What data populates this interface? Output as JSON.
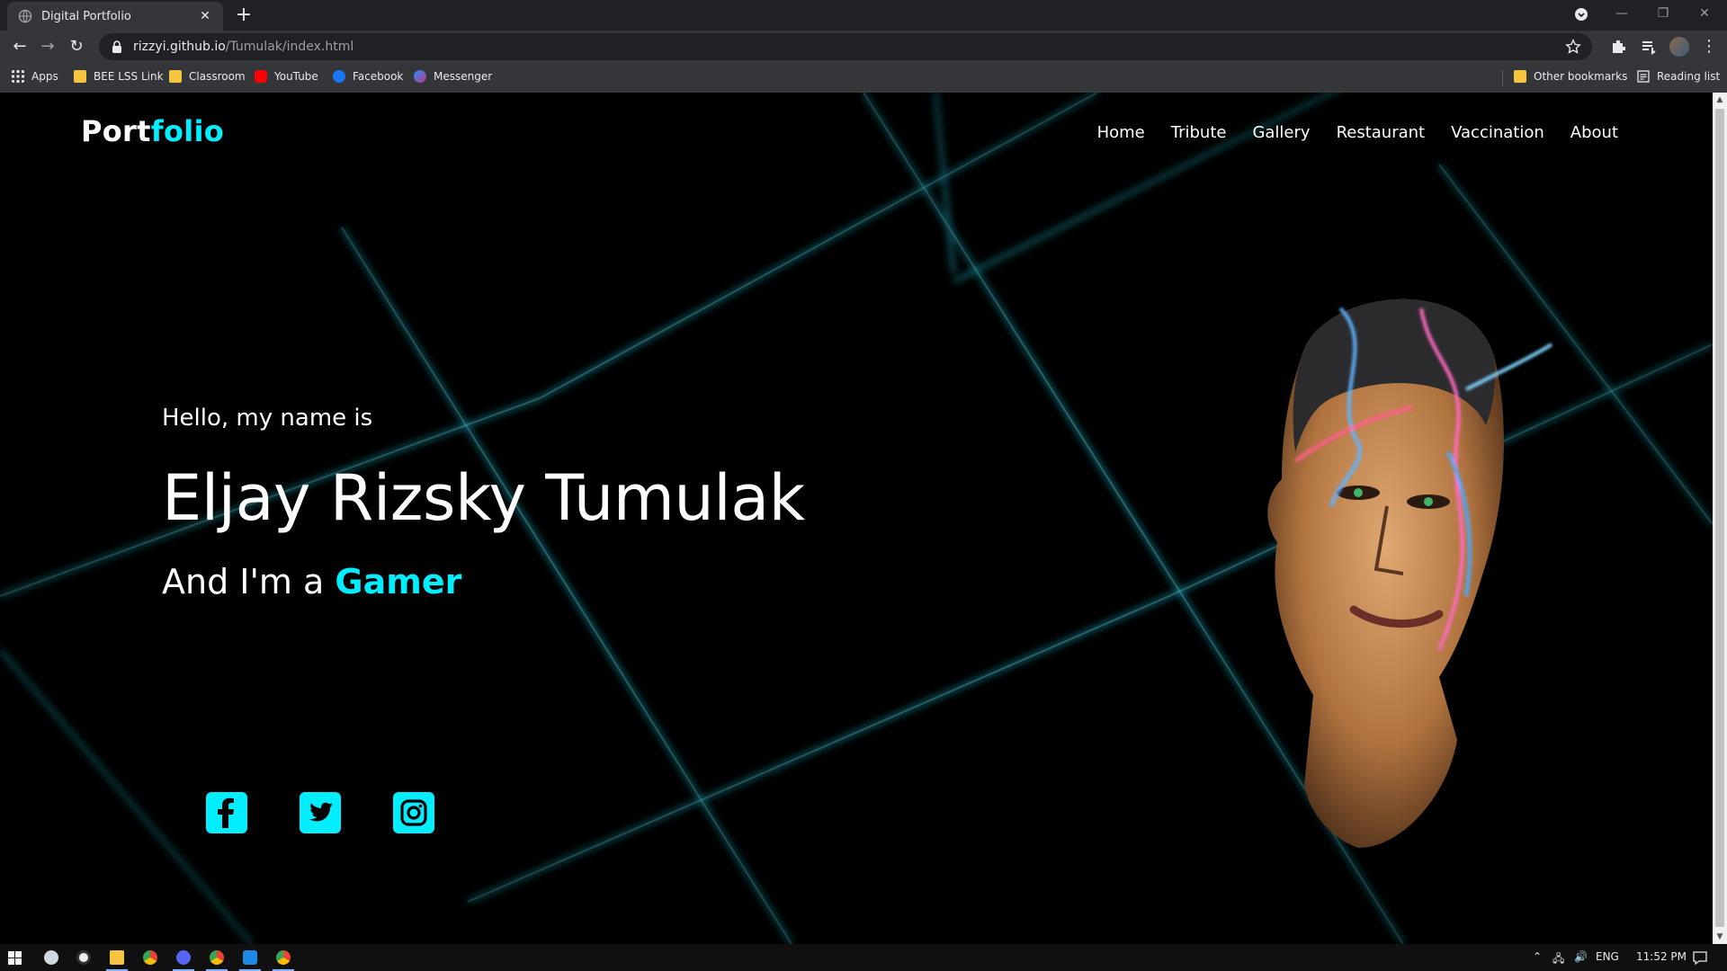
{
  "browser": {
    "tab_title": "Digital Portfolio",
    "new_tab": "+",
    "url_host": "rizzyi.github.io",
    "url_path": "/Tumulak/index.html",
    "bookmarks": [
      {
        "label": "Apps",
        "color": "#4285f4"
      },
      {
        "label": "BEE LSS Link",
        "color": "#f5c542"
      },
      {
        "label": "Classroom",
        "color": "#f5c542"
      },
      {
        "label": "YouTube",
        "color": "#ff0000"
      },
      {
        "label": "Facebook",
        "color": "#1877f2"
      },
      {
        "label": "Messenger",
        "color": "#a033ff"
      }
    ],
    "other_bookmarks": "Other bookmarks",
    "reading_list": "Reading list"
  },
  "site": {
    "brand_main": "Port",
    "brand_accent": "folio",
    "accent_color": "#00eeff",
    "nav": [
      "Home",
      "Tribute",
      "Gallery",
      "Restaurant",
      "Vaccination",
      "About"
    ]
  },
  "hero": {
    "greeting": "Hello, my name is",
    "name": "Eljay Rizsky Tumulak",
    "role_prefix": "And I'm a",
    "role_highlight": "Gamer"
  },
  "social": [
    "facebook-icon",
    "twitter-icon",
    "instagram-icon"
  ],
  "taskbar": {
    "language": "ENG",
    "time": "11:52 PM"
  }
}
